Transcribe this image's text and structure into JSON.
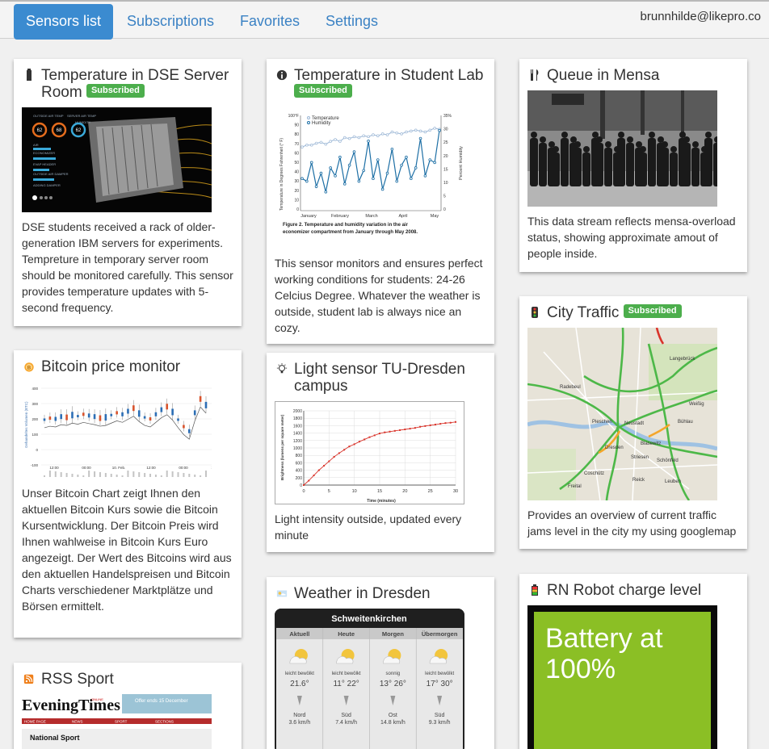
{
  "nav": {
    "tabs": [
      "Sensors list",
      "Subscriptions",
      "Favorites",
      "Settings"
    ],
    "user": "brunnhilde@likepro.co"
  },
  "badge": "Subscribed",
  "cards": {
    "dse": {
      "title": "Temperature in DSE Server Room",
      "desc": "DSE students received a rack of older-generation IBM servers for experiments. Tempreture in temporary server room should be monitored carefully. This sensor provides temperature updates with 5-second frequency."
    },
    "studentlab": {
      "title": "Temperature in Student Lab",
      "desc": "This sensor monitors and ensures perfect working conditions for students: 24-26 Celcius Degree. Whatever the weather is outside, student lab is always nice an cozy."
    },
    "mensa": {
      "title": "Queue in Mensa",
      "desc": "This data stream reflects mensa-overload status, showing approximate amout of people inside."
    },
    "bitcoin": {
      "title": "Bitcoin price monitor",
      "desc": "Unser Bitcoin Chart zeigt Ihnen den aktuellen Bitcoin Kurs sowie die Bitcoin Kursentwicklung. Der Bitcoin Preis wird Ihnen wahlweise in Bitcoin Kurs Euro angezeigt. Der Wert des Bitcoins wird aus den aktuellen Handelspreisen und Bitcoin Charts verschiedener Marktplätze und Börsen ermittelt."
    },
    "light": {
      "title": "Light sensor TU-Dresden campus",
      "desc": "Light intensity outside, updated every minute"
    },
    "traffic": {
      "title": "City Traffic",
      "desc": "Provides an overview of current traffic jams level in the city my using googlemap"
    },
    "weather": {
      "title": "Weather in Dresden"
    },
    "rss": {
      "title": "RSS Sport"
    },
    "robot": {
      "title": "RN Robot charge level"
    }
  },
  "imgs": {
    "dse_panel": [
      "OUTSIDE AIR TEMP",
      "SERVER AIR TEMP",
      "HUMIDITY",
      "AIR",
      "ECONOMIZER",
      "EVAP HEADER",
      "OUTSIDE AIR DAMPER",
      "ADDING DAMPER"
    ],
    "dse_gauges": [
      "62",
      "68",
      "62"
    ],
    "studentlab": {
      "legend": [
        "Temperature",
        "Humidity"
      ],
      "ylabel_left": "Temperature in Degrees Fahrenheit (° F)",
      "ylabel_right": "Percent Humidity",
      "y_left_ticks": [
        "100°F",
        "90",
        "80",
        "70",
        "60",
        "50",
        "40",
        "30",
        "20",
        "10",
        "0"
      ],
      "y_right_ticks": [
        "35%",
        "30",
        "25",
        "20",
        "15",
        "10",
        "5",
        "0"
      ],
      "x_ticks": [
        "January",
        "February",
        "March",
        "April",
        "May"
      ],
      "caption_bold": "Figure 2. Temperature and humidity variation in the air economizer compartment from January through May 2008."
    },
    "bitcoin": {
      "ylabel": "Gehandeltes Volumen (BTC)",
      "y_ticks": [
        "400",
        "300",
        "200",
        "100",
        "0",
        "-100"
      ],
      "x_ticks": [
        "12:00",
        "00:00",
        "10. Feb.",
        "12:00",
        "00:00",
        "12:00"
      ]
    },
    "light": {
      "ylabel": "Brightness (lumens per square meter)",
      "xlabel": "Time (minutes)",
      "y_ticks": [
        "2000",
        "1800",
        "1600",
        "1400",
        "1200",
        "1000",
        "800",
        "600",
        "400",
        "200",
        "0"
      ],
      "x_ticks": [
        "0",
        "5",
        "10",
        "15",
        "20",
        "25",
        "30"
      ]
    },
    "traffic_places": [
      "Radebeul",
      "Dresden",
      "Neustadt",
      "Pieschen",
      "Blasewitz",
      "Striesen",
      "Schönfeld",
      "Freital",
      "Coschütz",
      "Bühlau",
      "Weißig",
      "Langebrück",
      "Reick",
      "Leuben"
    ],
    "weather": {
      "location": "Schweitenkirchen",
      "days": [
        {
          "day": "Aktuell",
          "cond": "leicht bewölkt",
          "temp": "21.6°",
          "dir": "Nord",
          "wind": "3.6 km/h"
        },
        {
          "day": "Heute",
          "cond": "leicht bewölkt",
          "temp": "11° 22°",
          "dir": "Süd",
          "wind": "7.4 km/h"
        },
        {
          "day": "Morgen",
          "cond": "sonnig",
          "temp": "13° 26°",
          "dir": "Ost",
          "wind": "14.8 km/h"
        },
        {
          "day": "Übermorgen",
          "cond": "leicht bewölkt",
          "temp": "17° 30°",
          "dir": "Süd",
          "wind": "9.3 km/h"
        }
      ]
    },
    "rss": {
      "logo": "EveningTimes",
      "logo_small": "ONLINE",
      "offer": "Offer ends 15 December",
      "menu": [
        "HOME PAGE",
        "NEWS",
        "SPORT",
        "SECTIONS"
      ],
      "heading": "National Sport"
    },
    "robot": "Battery at 100%"
  },
  "chart_data": [
    {
      "type": "line",
      "caption": "Figure 2. Temperature and humidity variation in the air economizer compartment from January through May 2008.",
      "series": [
        {
          "name": "Temperature",
          "values": [
            68,
            70,
            70,
            72,
            73,
            71,
            74,
            76,
            74,
            78,
            77,
            79,
            78,
            80,
            79,
            81,
            80,
            82,
            81,
            84,
            83,
            82,
            84,
            85,
            86,
            85,
            84,
            86,
            88,
            87
          ]
        },
        {
          "name": "Humidity",
          "values": [
            12,
            11,
            18,
            9,
            14,
            7,
            16,
            13,
            20,
            10,
            17,
            22,
            11,
            15,
            26,
            12,
            19,
            8,
            14,
            23,
            11,
            17,
            20,
            12,
            16,
            27,
            13,
            19,
            18,
            30
          ]
        }
      ],
      "x": [
        "January",
        "February",
        "March",
        "April",
        "May"
      ]
    },
    {
      "type": "line",
      "xlabel": "Time (minutes)",
      "ylabel": "Brightness (lumens per square meter)",
      "x": [
        0,
        1,
        2,
        3,
        4,
        5,
        6,
        7,
        8,
        9,
        10,
        11,
        12,
        13,
        14,
        15,
        16,
        17,
        18,
        19,
        20,
        21,
        22,
        23,
        24,
        25,
        26,
        27,
        28,
        29,
        30
      ],
      "values": [
        0,
        120,
        260,
        400,
        520,
        640,
        760,
        860,
        950,
        1040,
        1100,
        1170,
        1230,
        1290,
        1340,
        1390,
        1420,
        1440,
        1460,
        1480,
        1500,
        1520,
        1540,
        1570,
        1590,
        1610,
        1630,
        1650,
        1670,
        1680,
        1700
      ],
      "xlim": [
        0,
        30
      ],
      "ylim": [
        0,
        2000
      ]
    },
    {
      "type": "line",
      "ylabel": "Gehandeltes Volumen (BTC)",
      "x": [
        "12:00",
        "00:00",
        "10. Feb.",
        "12:00",
        "00:00",
        "12:00"
      ],
      "values": [
        195,
        205,
        200,
        215,
        210,
        225,
        218,
        230,
        222,
        215,
        205,
        210,
        225,
        240,
        230,
        250,
        270,
        235,
        210,
        200,
        230,
        260,
        280,
        245,
        195,
        150,
        120,
        240,
        330,
        290
      ]
    }
  ]
}
